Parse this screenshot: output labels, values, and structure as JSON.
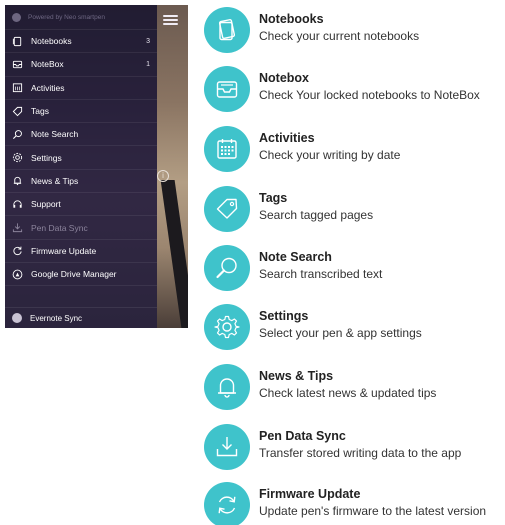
{
  "phone": {
    "header_text": "Powered by Neo smartpen",
    "menu_items": [
      {
        "label": "Notebooks",
        "count": "3",
        "icon": "notebooks-icon"
      },
      {
        "label": "NoteBox",
        "count": "1",
        "icon": "notebox-icon"
      },
      {
        "label": "Activities",
        "count": "",
        "icon": "calendar-icon"
      },
      {
        "label": "Tags",
        "count": "",
        "icon": "tag-icon"
      },
      {
        "label": "Note Search",
        "count": "",
        "icon": "search-icon"
      },
      {
        "label": "Settings",
        "count": "",
        "icon": "gear-icon"
      },
      {
        "label": "News & Tips",
        "count": "",
        "icon": "bell-icon"
      },
      {
        "label": "Support",
        "count": "",
        "icon": "headset-icon"
      },
      {
        "label": "Pen Data Sync",
        "count": "",
        "icon": "download-icon"
      },
      {
        "label": "Firmware Update",
        "count": "",
        "icon": "refresh-icon"
      },
      {
        "label": "Google Drive Manager",
        "count": "",
        "icon": "drive-icon"
      }
    ],
    "footer_label": "Evernote Sync"
  },
  "features": [
    {
      "title": "Notebooks",
      "desc": "Check your current notebooks",
      "icon": "notebooks-icon"
    },
    {
      "title": "Notebox",
      "desc": "Check Your locked notebooks to NoteBox",
      "icon": "notebox-icon"
    },
    {
      "title": "Activities",
      "desc": "Check your writing by date",
      "icon": "calendar-icon"
    },
    {
      "title": "Tags",
      "desc": "Search tagged pages",
      "icon": "tag-icon"
    },
    {
      "title": "Note Search",
      "desc": "Search transcribed text",
      "icon": "search-icon"
    },
    {
      "title": "Settings",
      "desc": "Select your pen & app settings",
      "icon": "gear-icon"
    },
    {
      "title": "News & Tips",
      "desc": "Check latest news & updated tips",
      "icon": "bell-icon"
    },
    {
      "title": "Pen Data Sync",
      "desc": "Transfer stored writing data to the app",
      "icon": "download-icon"
    },
    {
      "title": "Firmware Update",
      "desc": "Update pen's firmware to the latest version",
      "icon": "refresh-icon"
    }
  ],
  "colors": {
    "accent": "#3fc3cb",
    "menu_bg": "#2e2740"
  }
}
